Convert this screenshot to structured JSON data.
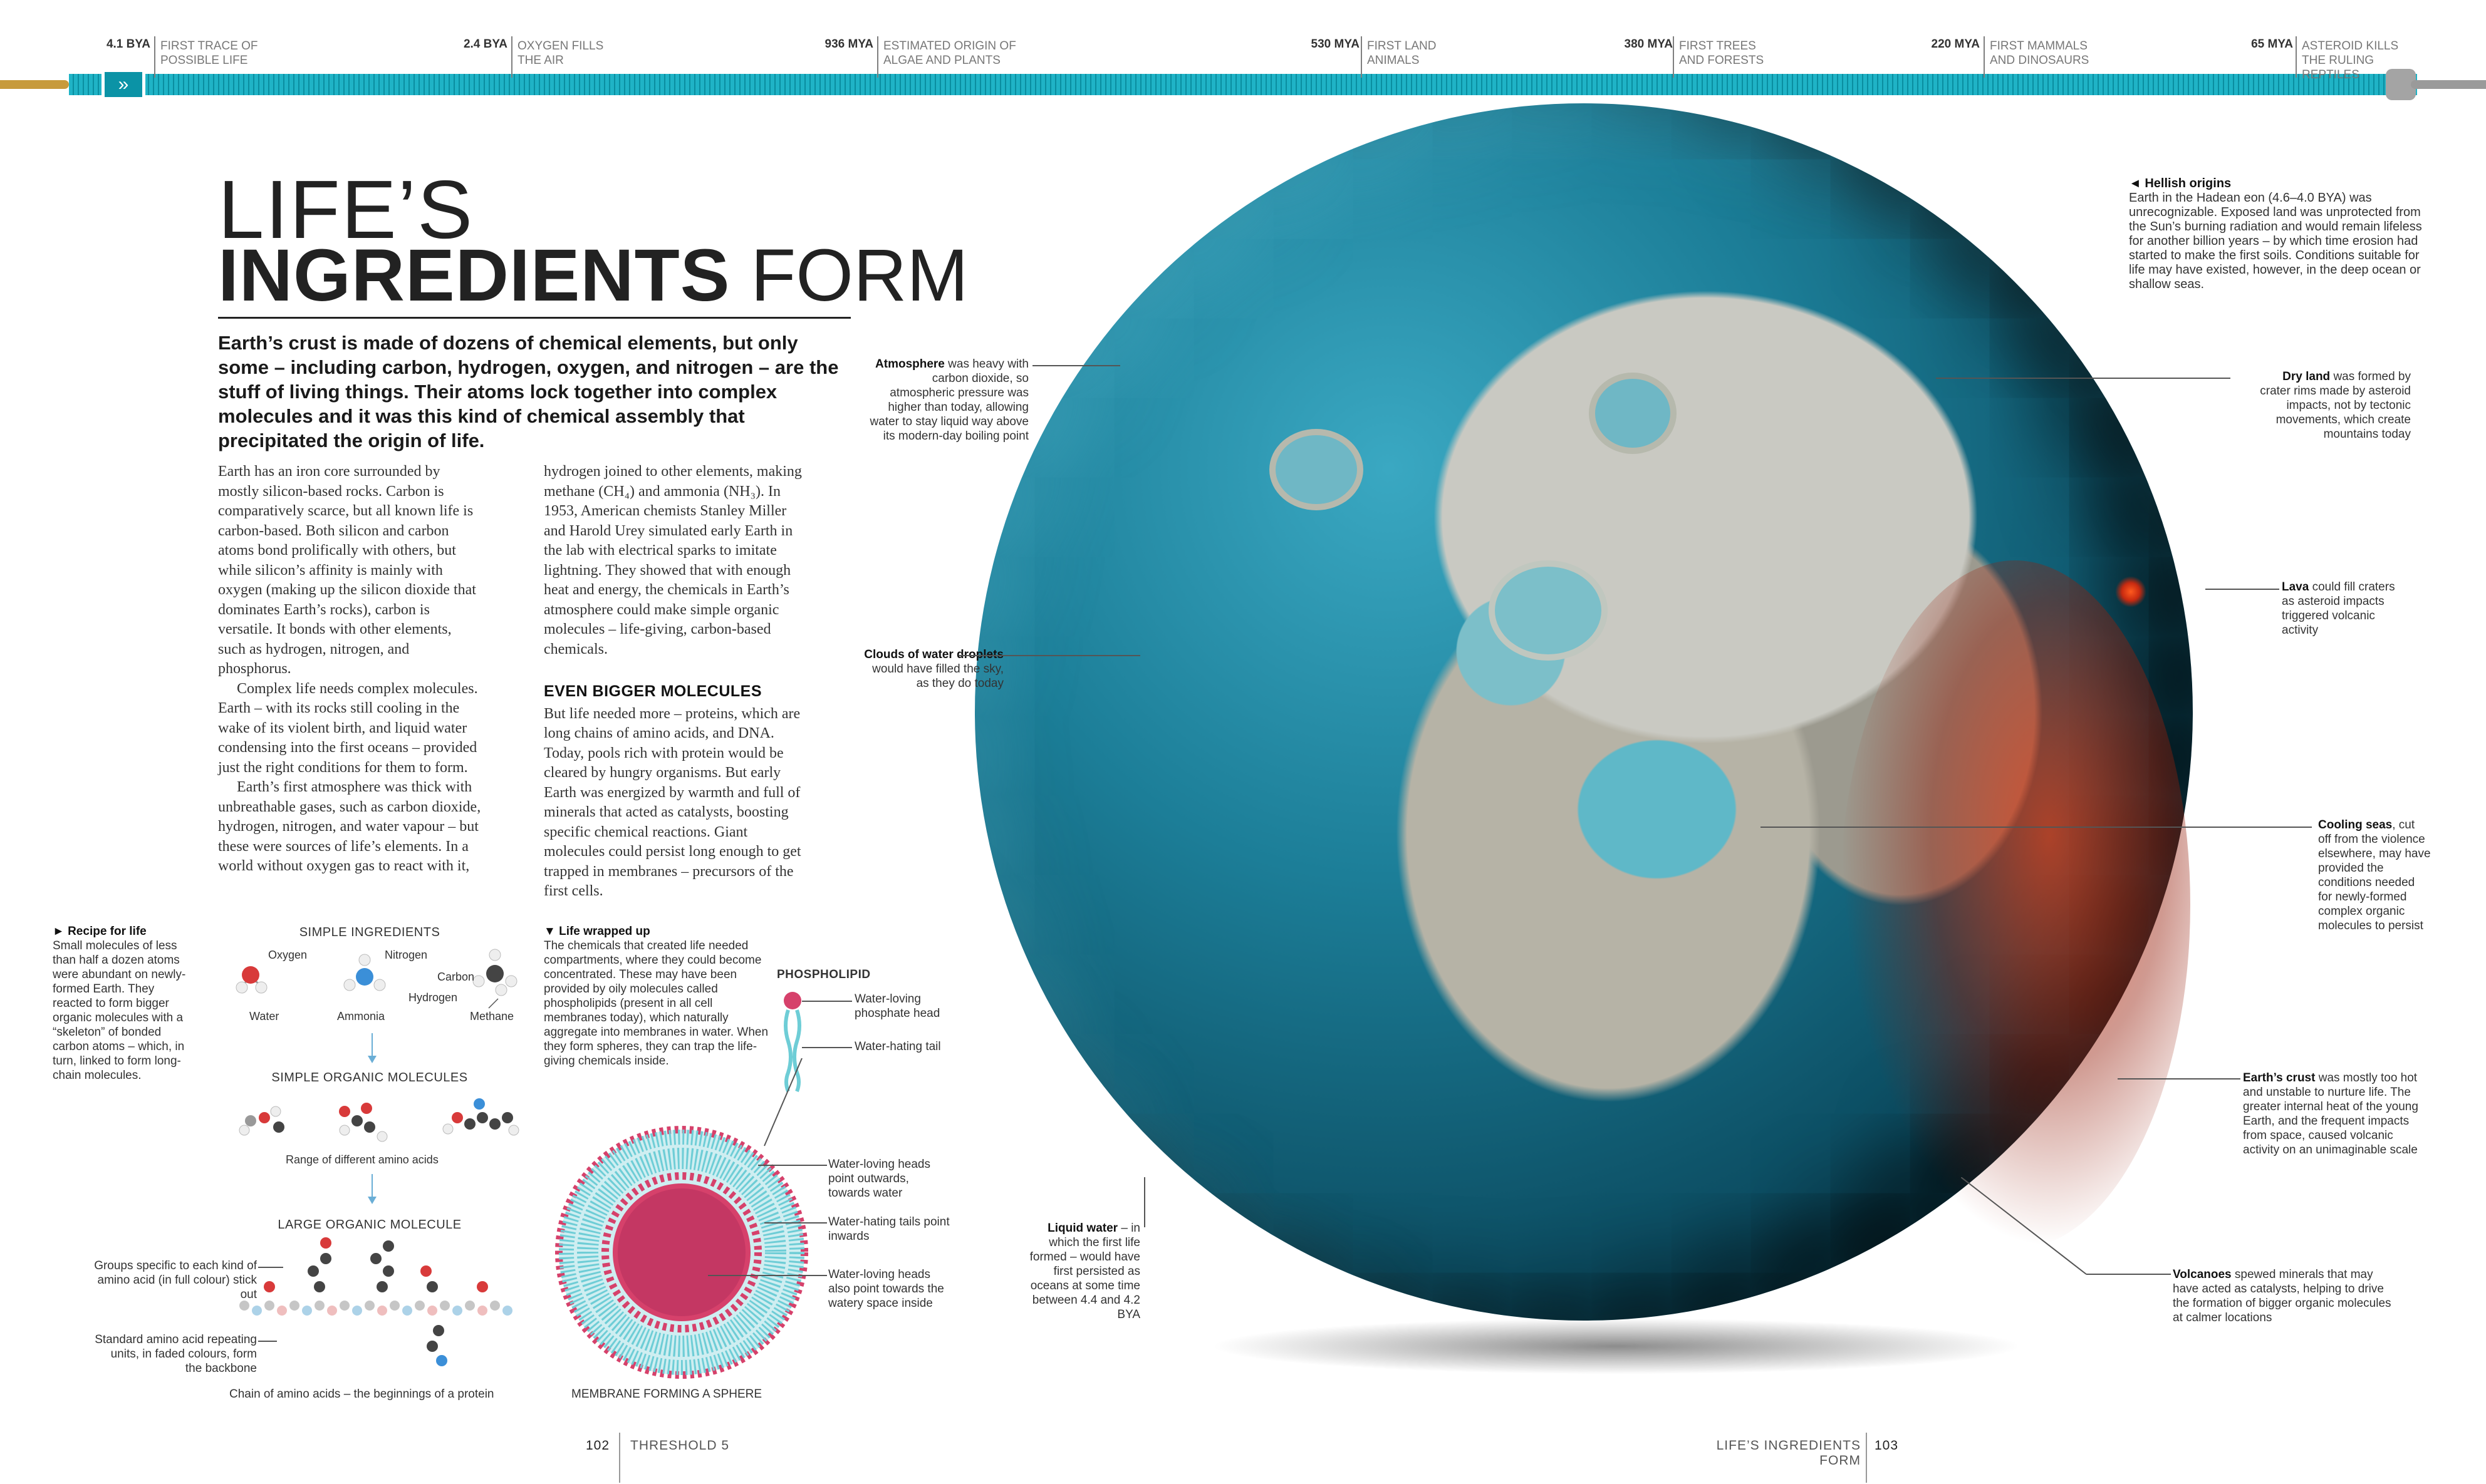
{
  "timeline": [
    {
      "date": "4.1 BYA",
      "label": "FIRST TRACE OF POSSIBLE LIFE"
    },
    {
      "date": "2.4 BYA",
      "label": "OXYGEN FILLS THE AIR"
    },
    {
      "date": "936 MYA",
      "label": "ESTIMATED ORIGIN OF ALGAE AND PLANTS"
    },
    {
      "date": "530 MYA",
      "label": "FIRST LAND ANIMALS"
    },
    {
      "date": "380 MYA",
      "label": "FIRST TREES AND FORESTS"
    },
    {
      "date": "220 MYA",
      "label": "FIRST MAMMALS AND DINOSAURS"
    },
    {
      "date": "65 MYA",
      "label": "ASTEROID KILLS THE RULING REPTILES"
    }
  ],
  "timeline_nav": "»",
  "title": {
    "line1": "LIFE’S",
    "line2_bold": "INGREDIENTS",
    "line2_light": " FORM"
  },
  "intro": "Earth’s crust is made of dozens of chemical elements, but only some – including carbon, hydrogen, oxygen, and nitrogen – are the stuff of living things. Their atoms lock together into complex molecules and it was this kind of chemical assembly that precipitated the origin of life.",
  "body": {
    "col1": [
      "Earth has an iron core surrounded by mostly silicon-based rocks. Carbon is comparatively scarce, but all known life is carbon-based. Both silicon and carbon atoms bond prolifically with others, but while silicon’s affinity is mainly with oxygen (making up the silicon dioxide that dominates Earth’s rocks), carbon is versatile. It bonds with other elements, such as hydrogen, nitrogen, and phosphorus.",
      "Complex life needs complex molecules. Earth – with its rocks still cooling in the wake of its violent birth, and liquid water condensing into the first oceans – provided just the right conditions for them to form.",
      "Earth’s first atmosphere was thick with unbreathable gases, such as carbon dioxide, hydrogen, nitrogen, and water vapour – but these were sources of life’s elements. In a world without oxygen gas to react with it,"
    ],
    "col2_p1": "hydrogen joined to other elements, making methane (CH₄) and ammonia (NH₃). In 1953, American chemists Stanley Miller and Harold Urey simulated early Earth in the lab with electrical sparks to imitate lightning. They showed that with enough heat and energy, the chemicals in Earth’s atmosphere could make simple organic molecules – life-giving, carbon-based chemicals.",
    "subhead": "EVEN BIGGER MOLECULES",
    "col2_p2": "But life needed more – proteins, which are long chains of amino acids, and DNA. Today, pools rich with protein would be cleared by hungry organisms. But early Earth was energized by warmth and full of minerals that acted as catalysts, boosting specific chemical reactions. Giant molecules could persist long enough to get trapped in membranes – precursors of the first cells."
  },
  "recipe": {
    "head": "► Recipe for life",
    "text": "Small molecules of less than half a dozen atoms were abundant on newly-formed Earth. They reacted to form bigger organic molecules with a “skeleton” of bonded carbon atoms – which, in turn, linked to form long-chain molecules."
  },
  "diagram": {
    "simple_ingredients": "SIMPLE INGREDIENTS",
    "oxygen": "Oxygen",
    "nitrogen": "Nitrogen",
    "carbon": "Carbon",
    "hydrogen": "Hydrogen",
    "water": "Water",
    "ammonia": "Ammonia",
    "methane": "Methane",
    "simple_organic": "SIMPLE ORGANIC MOLECULES",
    "range": "Range of different amino acids",
    "large_organic": "LARGE ORGANIC MOLECULE",
    "groups": "Groups specific to each kind of amino acid (in full colour) stick out",
    "standard": "Standard amino acid repeating units, in faded colours, form the backbone",
    "chain": "Chain of amino acids – the beginnings of a protein"
  },
  "wrapped": {
    "head": "▼ Life wrapped up",
    "text": "The chemicals that created life needed compartments, where they could become concentrated. These may have been provided by oily molecules called phospholipids (present in all cell membranes today), which naturally aggregate into membranes in water. When they form spheres, they can trap the life-giving chemicals inside."
  },
  "phospholipid": {
    "head": "PHOSPHOLIPID",
    "heads": "Water-loving phosphate head",
    "tail": "Water-hating tail",
    "out": "Water-loving heads point outwards, towards water",
    "in": "Water-hating tails point inwards",
    "inner": "Water-loving heads also point towards the watery space inside",
    "membrane": "MEMBRANE FORMING A SPHERE"
  },
  "earth_labels": {
    "atmosphere_b": "Atmosphere",
    "atmosphere": " was heavy with carbon dioxide, so atmospheric pressure was higher than today, allowing water to stay liquid way above its modern-day boiling point",
    "clouds_b": "Clouds of water droplets",
    "clouds": " would have filled the sky, as they do today",
    "liquid_b": "Liquid water",
    "liquid": " – in which the first life formed – would have first persisted as oceans at some time between 4.4 and 4.2 BYA",
    "hellish_head": "◄ Hellish origins",
    "hellish": "Earth in the Hadean eon (4.6–4.0 BYA) was unrecognizable. Exposed land was unprotected from the Sun’s burning radiation and would remain lifeless for another billion years – by which time erosion had started to make the first soils. Conditions suitable for life may have existed, however, in the deep ocean or shallow seas.",
    "dryland_b": "Dry land",
    "dryland": " was formed by crater rims made by asteroid impacts, not by tectonic movements, which create mountains today",
    "lava_b": "Lava",
    "lava": " could fill craters as asteroid impacts triggered volcanic activity",
    "cooling_b": "Cooling seas",
    "cooling": ", cut off from the violence elsewhere, may have provided the conditions needed for newly-formed complex organic molecules to persist",
    "crust_b": "Earth’s crust",
    "crust": " was mostly too hot and unstable to nurture life. The greater internal heat of the young Earth, and the frequent impacts from space, caused volcanic activity on an unimaginable scale",
    "volcano_b": "Volcanoes",
    "volcano": " spewed minerals that may have acted as catalysts, helping to drive the formation of bigger organic molecules at calmer locations"
  },
  "folio": {
    "left_num": "102",
    "left_label": "THRESHOLD 5",
    "right_label": "LIFE’S INGREDIENTS FORM",
    "right_num": "103"
  },
  "colors": {
    "teal": "#0a8ea0",
    "lava": "#e2401a",
    "gold": "#c79a3c"
  }
}
